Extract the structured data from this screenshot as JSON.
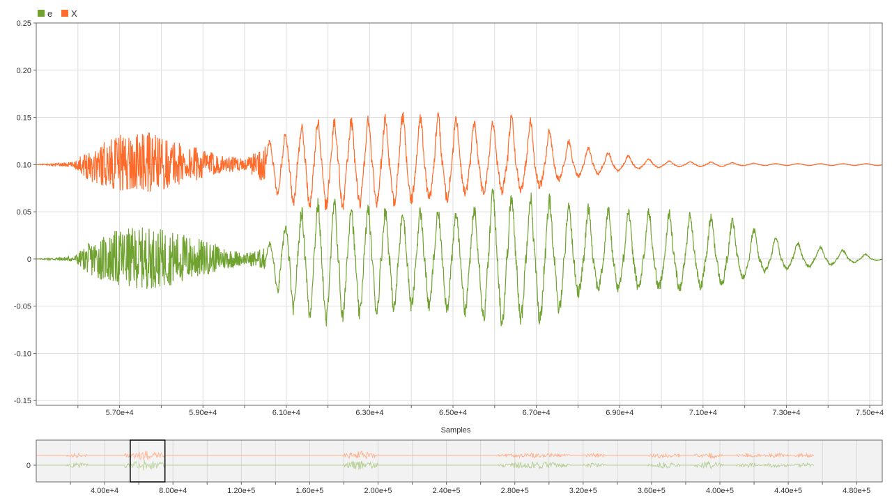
{
  "chart_data": [
    {
      "type": "line",
      "title": "",
      "xlabel": "Samples",
      "ylabel": "",
      "xlim": [
        55000,
        75300
      ],
      "ylim": [
        -0.155,
        0.25
      ],
      "yticks": [
        0.25,
        0.2,
        0.15,
        0.1,
        0.05,
        0,
        -0.05,
        -0.1,
        -0.15
      ],
      "ytick_labels": [
        "0.25",
        "0.20",
        "0.15",
        "0.10",
        "0.05",
        "0",
        "-0.05",
        "-0.10",
        "-0.15"
      ],
      "xticks": [
        57000,
        59000,
        61000,
        63000,
        65000,
        67000,
        69000,
        71000,
        73000,
        75000
      ],
      "xtick_labels": [
        "5.70e+4",
        "5.90e+4",
        "6.10e+4",
        "6.30e+4",
        "6.50e+4",
        "6.70e+4",
        "6.90e+4",
        "7.10e+4",
        "7.30e+4",
        "7.50e+4"
      ],
      "grid": true,
      "legend_position": "top-left",
      "series": [
        {
          "name": "e",
          "color": "#6fa22f",
          "offset": 0,
          "envelope_x": [
            55000,
            55900,
            56300,
            57000,
            57700,
            58500,
            59300,
            60000,
            60500,
            61000,
            61500,
            62000,
            62500,
            63000,
            63500,
            64000,
            64500,
            65000,
            65500,
            66000,
            66500,
            67000,
            67500,
            68000,
            68500,
            69000,
            69500,
            70000,
            70500,
            71000,
            71500,
            72000,
            72500,
            73000,
            73500,
            74000,
            74500,
            75000,
            75300
          ],
          "envelope_upper": [
            0.0,
            0.003,
            0.018,
            0.032,
            0.034,
            0.028,
            0.016,
            0.006,
            0.012,
            0.035,
            0.055,
            0.058,
            0.056,
            0.052,
            0.05,
            0.05,
            0.048,
            0.046,
            0.052,
            0.072,
            0.062,
            0.066,
            0.058,
            0.055,
            0.052,
            0.05,
            0.05,
            0.048,
            0.046,
            0.044,
            0.042,
            0.035,
            0.025,
            0.018,
            0.014,
            0.011,
            0.008,
            0.004,
            0.002
          ],
          "envelope_lower": [
            0.0,
            -0.003,
            -0.018,
            -0.03,
            -0.032,
            -0.026,
            -0.014,
            -0.006,
            -0.012,
            -0.05,
            -0.058,
            -0.067,
            -0.06,
            -0.056,
            -0.052,
            -0.05,
            -0.05,
            -0.052,
            -0.055,
            -0.068,
            -0.06,
            -0.066,
            -0.055,
            -0.035,
            -0.03,
            -0.03,
            -0.03,
            -0.03,
            -0.03,
            -0.028,
            -0.026,
            -0.018,
            -0.012,
            -0.01,
            -0.008,
            -0.006,
            -0.004,
            -0.002,
            -0.001
          ]
        },
        {
          "name": "X",
          "color": "#ff6b2b",
          "offset": 0.1,
          "envelope_x": [
            55000,
            55900,
            56300,
            57000,
            57700,
            58500,
            59300,
            60000,
            60500,
            61000,
            61500,
            62000,
            62500,
            63000,
            63500,
            64000,
            64500,
            65000,
            65500,
            66000,
            66500,
            67000,
            67500,
            68000,
            68500,
            69000,
            69500,
            70000,
            70500,
            71000,
            71500,
            72000,
            72500,
            73000,
            73500,
            74000,
            74500,
            75000,
            75300
          ],
          "envelope_upper": [
            0.0,
            0.003,
            0.018,
            0.032,
            0.034,
            0.024,
            0.012,
            0.006,
            0.022,
            0.033,
            0.042,
            0.045,
            0.045,
            0.047,
            0.048,
            0.052,
            0.05,
            0.048,
            0.045,
            0.046,
            0.05,
            0.044,
            0.03,
            0.02,
            0.014,
            0.01,
            0.007,
            0.004,
            0.003,
            0.003,
            0.002,
            0.002,
            0.001,
            0.001,
            0.001,
            0.001,
            0.001,
            0.001,
            0.001
          ],
          "envelope_lower": [
            0.0,
            -0.003,
            -0.018,
            -0.028,
            -0.03,
            -0.022,
            -0.01,
            -0.006,
            -0.02,
            -0.038,
            -0.043,
            -0.044,
            -0.042,
            -0.04,
            -0.04,
            -0.038,
            -0.036,
            -0.034,
            -0.03,
            -0.028,
            -0.026,
            -0.024,
            -0.016,
            -0.012,
            -0.009,
            -0.006,
            -0.004,
            -0.003,
            -0.002,
            -0.002,
            -0.002,
            -0.001,
            -0.001,
            -0.001,
            -0.001,
            -0.001,
            -0.001,
            -0.001,
            -0.001
          ]
        }
      ]
    },
    {
      "type": "line",
      "title": "",
      "xlabel": "",
      "ylabel": "",
      "xlim": [
        0,
        495000
      ],
      "xticks": [
        40000,
        80000,
        120000,
        160000,
        200000,
        240000,
        280000,
        320000,
        360000,
        400000,
        440000,
        480000
      ],
      "xtick_labels": [
        "4.00e+4",
        "8.00e+4",
        "1.20e+5",
        "1.60e+5",
        "2.00e+5",
        "2.40e+5",
        "2.80e+5",
        "3.20e+5",
        "3.60e+5",
        "4.00e+5",
        "4.40e+5",
        "4.80e+5"
      ],
      "yticks": [
        0
      ],
      "ytick_labels": [
        "0"
      ],
      "grid": true,
      "selection_range": [
        55000,
        75300
      ],
      "series": [
        {
          "name": "e",
          "color": "#b5cf94",
          "bursts": [
            [
              18000,
              30000,
              0.35
            ],
            [
              52000,
              75000,
              0.7
            ],
            [
              180000,
              200000,
              0.6
            ],
            [
              270000,
              312000,
              0.45
            ],
            [
              320000,
              333000,
              0.3
            ],
            [
              358000,
              377000,
              0.4
            ],
            [
              385000,
              402000,
              0.45
            ],
            [
              410000,
              424000,
              0.3
            ],
            [
              426000,
              440000,
              0.35
            ],
            [
              444000,
              455000,
              0.3
            ]
          ]
        },
        {
          "name": "X",
          "color": "#ffb08c",
          "bursts": [
            [
              18000,
              30000,
              0.3
            ],
            [
              52000,
              75000,
              0.6
            ],
            [
              180000,
              200000,
              0.55
            ],
            [
              270000,
              312000,
              0.3
            ],
            [
              320000,
              333000,
              0.3
            ],
            [
              358000,
              377000,
              0.35
            ],
            [
              385000,
              402000,
              0.4
            ],
            [
              410000,
              424000,
              0.3
            ],
            [
              426000,
              440000,
              0.3
            ],
            [
              444000,
              455000,
              0.3
            ]
          ]
        }
      ]
    }
  ]
}
